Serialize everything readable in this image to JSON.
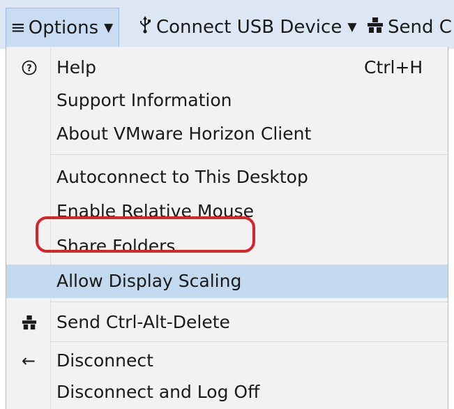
{
  "toolbar": {
    "options_icon": "hamburger-icon",
    "options_label": "Options",
    "usb_icon": "usb-icon",
    "usb_label": "Connect USB Device",
    "send_icon": "keyboard-keys-icon",
    "send_label": "Send C"
  },
  "menu": {
    "items": [
      {
        "label": "Help",
        "icon": "help-circle-icon",
        "shortcut": "Ctrl+H"
      },
      {
        "label": "Support Information"
      },
      {
        "label": "About VMware Horizon Client"
      },
      {
        "label": "Autoconnect to This Desktop"
      },
      {
        "label": "Enable Relative Mouse"
      },
      {
        "label": "Share Folders"
      },
      {
        "label": "Allow Display Scaling",
        "highlighted": true
      },
      {
        "label": "Send Ctrl-Alt-Delete",
        "icon": "keyboard-keys-icon"
      },
      {
        "label": "Disconnect",
        "icon": "arrow-left-icon"
      },
      {
        "label": "Disconnect and Log Off"
      }
    ]
  },
  "colors": {
    "toolbar_bg": "#dde7f3",
    "highlight_bg": "#c3d9ee",
    "annotation_ring": "#d8232a"
  }
}
